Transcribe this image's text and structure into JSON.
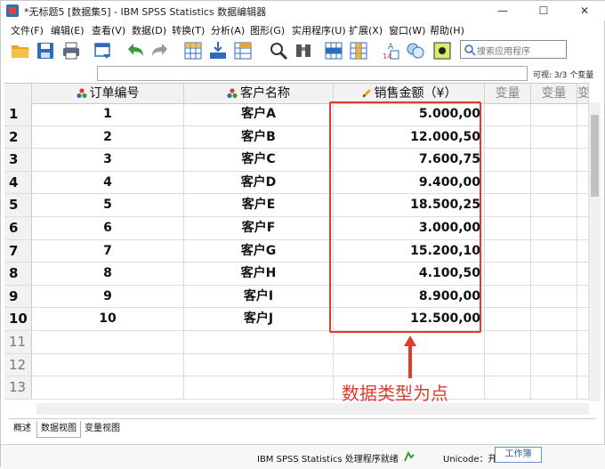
{
  "window": {
    "title": "*无标题5 [数据集5] - IBM SPSS Statistics 数据编辑器",
    "minimize": "—",
    "maximize": "☐",
    "close": "✕"
  },
  "menu": [
    "文件(F)",
    "编辑(E)",
    "查看(V)",
    "数据(D)",
    "转换(T)",
    "分析(A)",
    "图形(G)",
    "实用程序(U)",
    "扩展(X)",
    "窗口(W)",
    "帮助(H)"
  ],
  "toolbar": {
    "icons": [
      "open-folder-icon",
      "save-icon",
      "print-icon",
      "dialog-recall-icon",
      "undo-icon",
      "redo-icon",
      "goto-case-icon",
      "goto-variable-icon",
      "variables-icon",
      "find-icon",
      "insert-cases-icon",
      "insert-variable-icon",
      "split-file-icon",
      "weight-cases-icon",
      "select-cases-icon",
      "value-labels-icon",
      "use-sets-icon"
    ],
    "search_placeholder": "搜索应用程序"
  },
  "cell_editor": {
    "value": "",
    "visible_count": "可视: 3/3 个变量"
  },
  "grid": {
    "columns": [
      {
        "label": "订单编号",
        "icon": "nominal-measure-icon"
      },
      {
        "label": "客户名称",
        "icon": "nominal-measure-icon"
      },
      {
        "label": "销售金额（¥）",
        "icon": "scale-measure-icon"
      },
      {
        "label": "变量",
        "icon": ""
      },
      {
        "label": "变量",
        "icon": ""
      },
      {
        "label": "变",
        "icon": ""
      }
    ],
    "rows": [
      {
        "n": "1",
        "id": "1",
        "customer": "客户A",
        "amount": "5.000,00"
      },
      {
        "n": "2",
        "id": "2",
        "customer": "客户B",
        "amount": "12.000,50"
      },
      {
        "n": "3",
        "id": "3",
        "customer": "客户C",
        "amount": "7.600,75"
      },
      {
        "n": "4",
        "id": "4",
        "customer": "客户D",
        "amount": "9.400,00"
      },
      {
        "n": "5",
        "id": "5",
        "customer": "客户E",
        "amount": "18.500,25"
      },
      {
        "n": "6",
        "id": "6",
        "customer": "客户F",
        "amount": "3.000,00"
      },
      {
        "n": "7",
        "id": "7",
        "customer": "客户G",
        "amount": "15.200,10"
      },
      {
        "n": "8",
        "id": "8",
        "customer": "客户H",
        "amount": "4.100,50"
      },
      {
        "n": "9",
        "id": "9",
        "customer": "客户I",
        "amount": "8.900,00"
      },
      {
        "n": "10",
        "id": "10",
        "customer": "客户J",
        "amount": "12.500,00"
      },
      {
        "n": "11",
        "id": "",
        "customer": "",
        "amount": ""
      },
      {
        "n": "12",
        "id": "",
        "customer": "",
        "amount": ""
      },
      {
        "n": "13",
        "id": "",
        "customer": "",
        "amount": ""
      }
    ]
  },
  "annotation": {
    "text": "数据类型为点",
    "color": "#e03b2c"
  },
  "tabs": {
    "overview": "概述",
    "data_view": "数据视图",
    "variable_view": "变量视图"
  },
  "status": {
    "processor": "IBM SPSS Statistics 处理程序就绪",
    "unicode": "Unicode：开",
    "workspace": "工作簿"
  }
}
